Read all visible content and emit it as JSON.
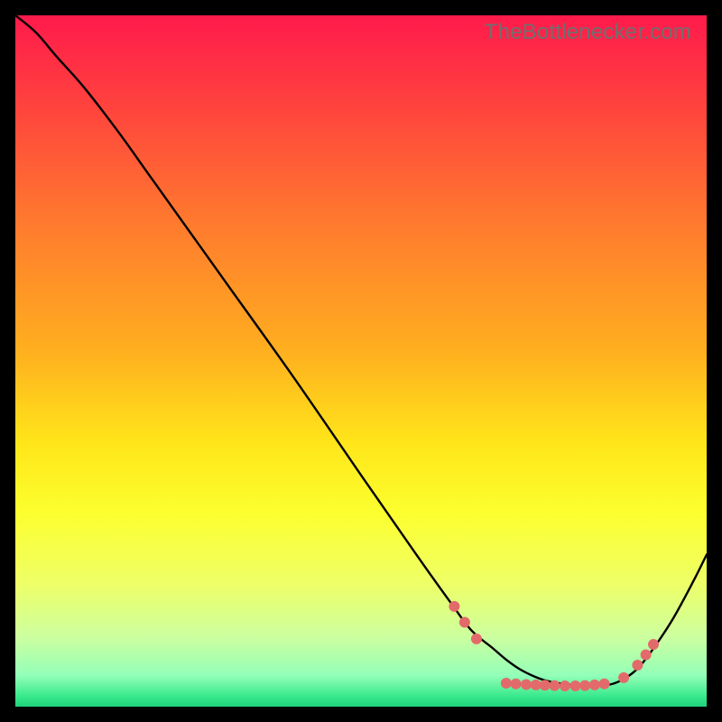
{
  "watermark": "TheBottlenecker.com",
  "chart_data": {
    "type": "line",
    "title": "",
    "xlabel": "",
    "ylabel": "",
    "xlim": [
      0,
      100
    ],
    "ylim": [
      0,
      100
    ],
    "background_gradient": {
      "stops": [
        {
          "offset": 0.0,
          "color": "#ff1a4b"
        },
        {
          "offset": 0.12,
          "color": "#ff3f3f"
        },
        {
          "offset": 0.3,
          "color": "#ff7a2e"
        },
        {
          "offset": 0.48,
          "color": "#ffad1f"
        },
        {
          "offset": 0.62,
          "color": "#ffe61a"
        },
        {
          "offset": 0.72,
          "color": "#fcff2e"
        },
        {
          "offset": 0.82,
          "color": "#efff66"
        },
        {
          "offset": 0.9,
          "color": "#ccffa0"
        },
        {
          "offset": 0.955,
          "color": "#93ffb8"
        },
        {
          "offset": 0.985,
          "color": "#39e98d"
        },
        {
          "offset": 1.0,
          "color": "#1fd07a"
        }
      ]
    },
    "series": [
      {
        "name": "bottleneck-curve",
        "color": "#000000",
        "x": [
          0,
          3,
          6,
          10,
          15,
          20,
          30,
          40,
          50,
          58,
          63,
          66,
          69,
          71,
          73,
          75,
          77,
          80,
          83,
          86,
          88,
          90,
          92,
          95,
          98,
          100
        ],
        "y": [
          100,
          97.5,
          94,
          89.5,
          83,
          76,
          62,
          48,
          33.5,
          22,
          15,
          11,
          8.5,
          6.8,
          5.4,
          4.4,
          3.7,
          3.2,
          3.0,
          3.2,
          4.0,
          5.5,
          8.0,
          12.5,
          18.0,
          22.0
        ]
      }
    ],
    "markers": {
      "name": "optimal-region-dots",
      "color": "#e36a6a",
      "radius": 6,
      "points": [
        {
          "x": 63.5,
          "y": 14.5
        },
        {
          "x": 65.0,
          "y": 12.2
        },
        {
          "x": 66.7,
          "y": 9.8
        },
        {
          "x": 71.0,
          "y": 3.4
        },
        {
          "x": 72.4,
          "y": 3.3
        },
        {
          "x": 73.9,
          "y": 3.2
        },
        {
          "x": 75.3,
          "y": 3.15
        },
        {
          "x": 76.6,
          "y": 3.1
        },
        {
          "x": 78.0,
          "y": 3.05
        },
        {
          "x": 79.5,
          "y": 3.0
        },
        {
          "x": 81.0,
          "y": 3.0
        },
        {
          "x": 82.4,
          "y": 3.05
        },
        {
          "x": 83.8,
          "y": 3.15
        },
        {
          "x": 85.2,
          "y": 3.3
        },
        {
          "x": 88.0,
          "y": 4.2
        },
        {
          "x": 90.0,
          "y": 6.0
        },
        {
          "x": 91.2,
          "y": 7.5
        },
        {
          "x": 92.3,
          "y": 9.0
        }
      ]
    }
  }
}
